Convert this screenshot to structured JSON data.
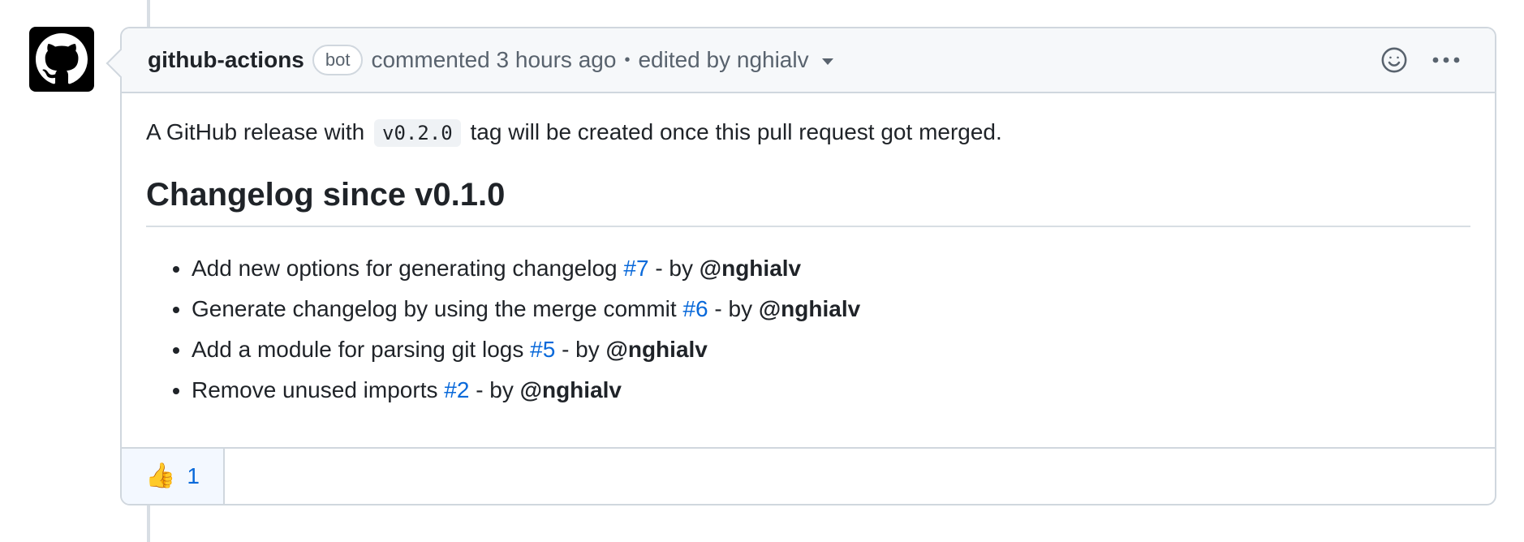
{
  "comment": {
    "author": "github-actions",
    "badge": "bot",
    "action_text": "commented 3 hours ago",
    "separator": "•",
    "edited_text": "edited by nghialv",
    "body": {
      "intro_before": "A GitHub release with",
      "intro_code": "v0.2.0",
      "intro_after": "tag will be created once this pull request got merged.",
      "heading": "Changelog since v0.1.0",
      "items": [
        {
          "text": "Add new options for generating changelog",
          "pr": "#7",
          "by": "- by",
          "mention": "@nghialv"
        },
        {
          "text": "Generate changelog by using the merge commit",
          "pr": "#6",
          "by": "- by",
          "mention": "@nghialv"
        },
        {
          "text": "Add a module for parsing git logs",
          "pr": "#5",
          "by": "- by",
          "mention": "@nghialv"
        },
        {
          "text": "Remove unused imports",
          "pr": "#2",
          "by": "- by",
          "mention": "@nghialv"
        }
      ]
    },
    "reactions": [
      {
        "emoji": "👍",
        "icon": "thumbs-up-icon",
        "count": "1"
      }
    ]
  },
  "icons": {
    "avatar": "github-octocat-icon",
    "add_reaction": "smiley-icon",
    "more": "kebab-horizontal-icon",
    "edit_history": "caret-down-icon"
  },
  "colors": {
    "link": "#0969da",
    "text": "#1f2328",
    "muted": "#59636e",
    "border": "#d0d7de",
    "header_bg": "#f6f8fa",
    "reaction_bg": "#f3f8ff"
  }
}
